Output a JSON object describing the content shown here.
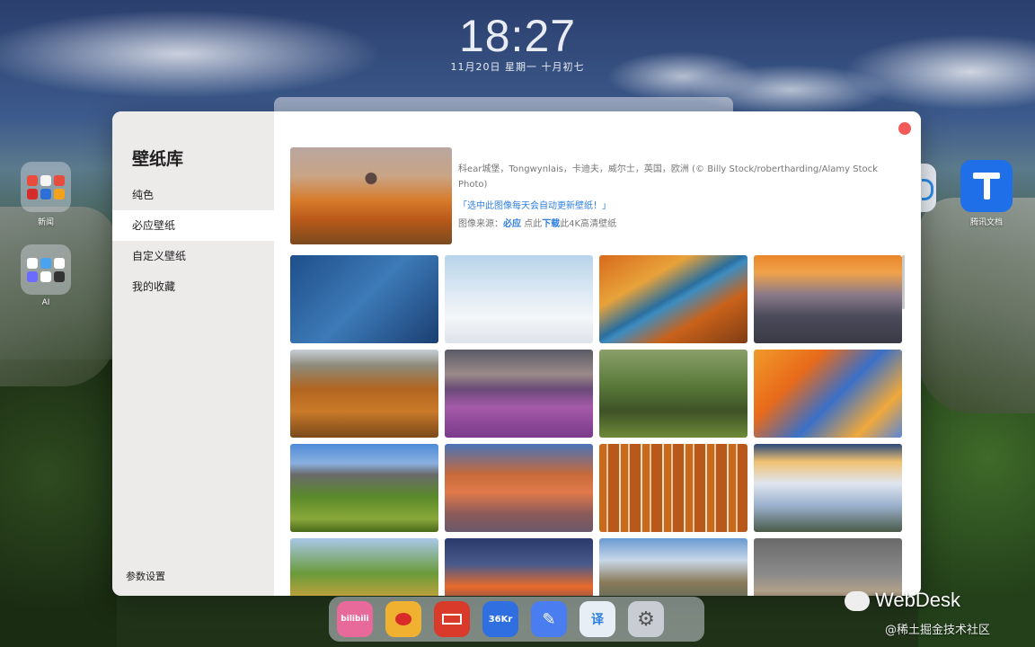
{
  "lockscreen": {
    "time": "18:27",
    "date": "11月20日 星期一 十月初七"
  },
  "desktop": {
    "icons": [
      {
        "label": "新闻"
      },
      {
        "label": "AI"
      },
      {
        "label": "腾讯文档"
      }
    ]
  },
  "sidebar": {
    "title": "壁纸库",
    "items": [
      {
        "label": "纯色"
      },
      {
        "label": "必应壁纸"
      },
      {
        "label": "自定义壁纸"
      },
      {
        "label": "我的收藏"
      }
    ],
    "active_index": 1,
    "footer": "参数设置"
  },
  "featured": {
    "description": "科ear城堡，Tongwynlais，卡迪夫，威尔士，英国，欧洲 (© Billy Stock/robertharding/Alamy Stock Photo)",
    "set_daily_link": "「选中此图像每天会自动更新壁纸！」",
    "source_prefix": "图像来源：",
    "source_name": "必应",
    "source_mid": " 点此",
    "download_label": "下载",
    "source_suffix": "此4K高清壁纸"
  },
  "thumbnails": [
    {
      "name": "frozen-lake"
    },
    {
      "name": "polar-bear"
    },
    {
      "name": "autumn-river"
    },
    {
      "name": "city-sunset"
    },
    {
      "name": "river-delta"
    },
    {
      "name": "lupine-field"
    },
    {
      "name": "olive-trees"
    },
    {
      "name": "ducks-autumn-water"
    },
    {
      "name": "dolomites-valley"
    },
    {
      "name": "badlands"
    },
    {
      "name": "birch-forest"
    },
    {
      "name": "sea-cliffs-fog"
    },
    {
      "name": "lake-rock"
    },
    {
      "name": "mountain-sunrise"
    },
    {
      "name": "rocky-coast"
    },
    {
      "name": "wildebeest"
    }
  ],
  "dock": {
    "apps": [
      {
        "label": "bilibili",
        "color": "#e86a9a"
      },
      {
        "label": "微博",
        "color": "#f0b030"
      },
      {
        "label": "凤凰",
        "color": "#d93a2a"
      },
      {
        "label": "36Kr",
        "color": "#2f6fe0"
      },
      {
        "label": "笔记",
        "color": "#4a7ef0"
      },
      {
        "label": "译",
        "color": "#e8eef6"
      },
      {
        "label": "设置",
        "color": "#c9ccd2"
      }
    ]
  },
  "watermark": {
    "brand": "WebDesk",
    "site": "@稀土掘金技术社区"
  }
}
